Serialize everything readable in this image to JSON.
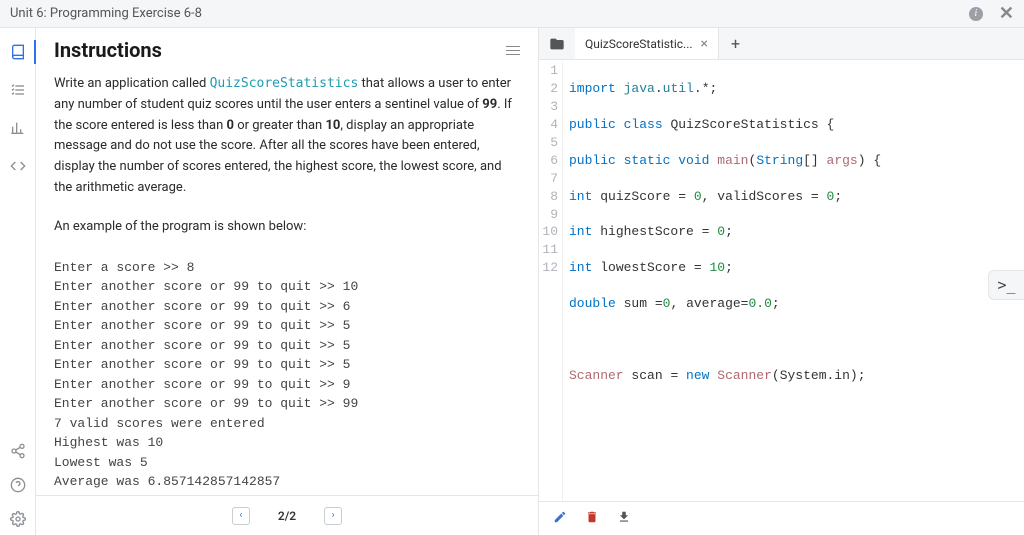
{
  "topbar": {
    "title": "Unit 6: Programming Exercise 6-8"
  },
  "left": {
    "heading": "Instructions",
    "para_parts": {
      "t1": "Write an application called ",
      "code1": "QuizScoreStatistics",
      "t2": " that allows a user to enter any number of student quiz scores until the user enters a sentinel value of ",
      "b1": "99",
      "t3": ". If the score entered is less than ",
      "b2": "0",
      "t4": " or greater than ",
      "b3": "10",
      "t5": ", display an appropriate message and do not use the score. After all the scores have been entered, display the number of scores entered, the highest score, the lowest score, and the arithmetic average."
    },
    "example_lead": "An example of the program is shown below:",
    "example_block": "Enter a score >> 8\nEnter another score or 99 to quit >> 10\nEnter another score or 99 to quit >> 6\nEnter another score or 99 to quit >> 5\nEnter another score or 99 to quit >> 5\nEnter another score or 99 to quit >> 5\nEnter another score or 99 to quit >> 9\nEnter another score or 99 to quit >> 99\n7 valid scores were entered\nHighest was 10\nLowest was 5\nAverage was 6.857142857142857",
    "pager": {
      "label": "2/2"
    }
  },
  "right": {
    "tab_label": "QuizScoreStatistic...",
    "code_data": {
      "line1": {
        "kw1": "import",
        "pkg": "java",
        "pkg2": "util",
        "star": "*"
      },
      "line2": {
        "kw1": "public",
        "kw2": "class",
        "cls": "QuizScoreStatistics",
        "brace": "{"
      },
      "line3": {
        "kw1": "public",
        "kw2": "static",
        "kw3": "void",
        "fn": "main",
        "arg_t": "String",
        "arg_n": "args"
      },
      "line4": {
        "kw": "int",
        "v1": "quizScore",
        "n1": "0",
        "v2": "validScores",
        "n2": "0"
      },
      "line5": {
        "kw": "int",
        "v": "highestScore",
        "n": "0"
      },
      "line6": {
        "kw": "int",
        "v": "lowestScore",
        "n": "10"
      },
      "line7": {
        "kw": "double",
        "v1": "sum",
        "n1": "0",
        "v2": "average",
        "n2": "0.0"
      },
      "line9": {
        "t": "Scanner",
        "v": "scan",
        "kw": "new",
        "cls": "Scanner",
        "arg": "System.in"
      }
    },
    "line_numbers": [
      "1",
      "2",
      "3",
      "4",
      "5",
      "6",
      "7",
      "8",
      "9",
      "10",
      "11",
      "12"
    ]
  },
  "term_toggle": ">_"
}
